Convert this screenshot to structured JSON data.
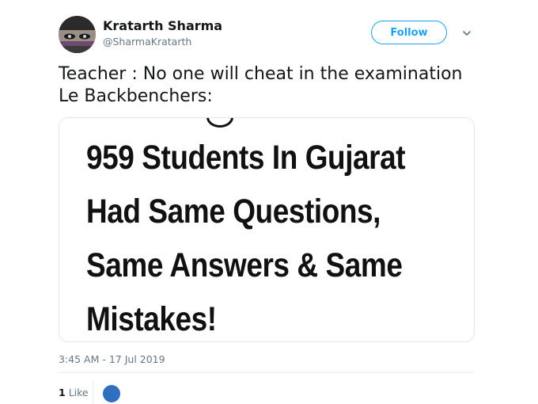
{
  "user": {
    "display_name": "Kratarth Sharma",
    "handle": "@SharmaKratarth",
    "avatar_icon": "avatar-photo"
  },
  "actions": {
    "follow_label": "Follow",
    "caret_icon": "chevron-down-icon"
  },
  "tweet": {
    "lines": [
      "Teacher : No one will cheat in the examination",
      "Le Backbenchers:"
    ],
    "media": {
      "headline_lines": [
        "959 Students In Gujarat",
        "Had Same Questions,",
        "Same Answers & Same",
        "Mistakes!"
      ]
    },
    "timestamp": "3:45 AM - 17 Jul 2019"
  },
  "engagement": {
    "like_count": "1",
    "like_label": "Like"
  },
  "colors": {
    "accent": "#1da1f2",
    "secondary_text": "#657786",
    "border": "#e1e8ed",
    "liker_avatar": "#2e6fbf"
  }
}
